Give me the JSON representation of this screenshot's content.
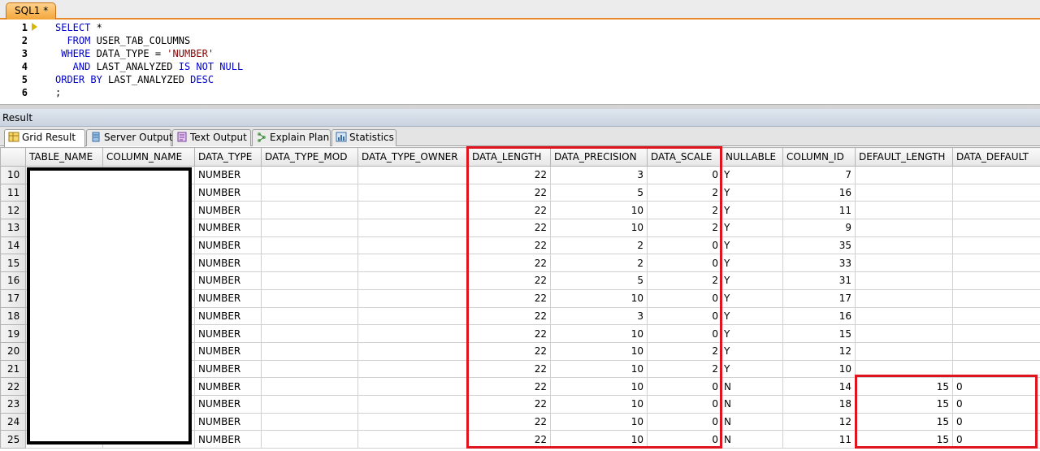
{
  "editor": {
    "tab_label": "SQL1 *",
    "line_numbers": [
      "1",
      "2",
      "3",
      "4",
      "5",
      "6"
    ],
    "lines": [
      [
        {
          "t": "SELECT",
          "k": "kw"
        },
        {
          "t": " *",
          "k": "plain"
        }
      ],
      [
        {
          "t": "  FROM",
          "k": "kw"
        },
        {
          "t": " USER_TAB_COLUMNS",
          "k": "plain"
        }
      ],
      [
        {
          "t": " WHERE",
          "k": "kw"
        },
        {
          "t": " DATA_TYPE = ",
          "k": "plain"
        },
        {
          "t": "'NUMBER'",
          "k": "str"
        }
      ],
      [
        {
          "t": "   AND",
          "k": "kw"
        },
        {
          "t": " LAST_ANALYZED ",
          "k": "plain"
        },
        {
          "t": "IS NOT NULL",
          "k": "kw"
        }
      ],
      [
        {
          "t": "ORDER BY",
          "k": "kw"
        },
        {
          "t": " LAST_ANALYZED ",
          "k": "plain"
        },
        {
          "t": "DESC",
          "k": "kw"
        }
      ],
      [
        {
          "t": ";",
          "k": "plain"
        }
      ]
    ]
  },
  "result": {
    "title": "Result",
    "tabs": [
      {
        "label": "Grid Result",
        "icon": "grid-result-icon",
        "active": true
      },
      {
        "label": "Server Output",
        "icon": "server-output-icon",
        "active": false
      },
      {
        "label": "Text Output",
        "icon": "text-output-icon",
        "active": false
      },
      {
        "label": "Explain Plan",
        "icon": "explain-plan-icon",
        "active": false
      },
      {
        "label": "Statistics",
        "icon": "statistics-icon",
        "active": false
      }
    ]
  },
  "grid": {
    "columns": [
      "TABLE_NAME",
      "COLUMN_NAME",
      "DATA_TYPE",
      "DATA_TYPE_MOD",
      "DATA_TYPE_OWNER",
      "DATA_LENGTH",
      "DATA_PRECISION",
      "DATA_SCALE",
      "NULLABLE",
      "COLUMN_ID",
      "DEFAULT_LENGTH",
      "DATA_DEFAULT"
    ],
    "rows": [
      {
        "n": "10",
        "cells": [
          "",
          "",
          "NUMBER",
          "",
          "",
          "22",
          "3",
          "0",
          "Y",
          "7",
          "",
          ""
        ]
      },
      {
        "n": "11",
        "cells": [
          "",
          "",
          "NUMBER",
          "",
          "",
          "22",
          "5",
          "2",
          "Y",
          "16",
          "",
          ""
        ]
      },
      {
        "n": "12",
        "cells": [
          "",
          "",
          "NUMBER",
          "",
          "",
          "22",
          "10",
          "2",
          "Y",
          "11",
          "",
          ""
        ]
      },
      {
        "n": "13",
        "cells": [
          "",
          "",
          "NUMBER",
          "",
          "",
          "22",
          "10",
          "2",
          "Y",
          "9",
          "",
          ""
        ]
      },
      {
        "n": "14",
        "cells": [
          "",
          "",
          "NUMBER",
          "",
          "",
          "22",
          "2",
          "0",
          "Y",
          "35",
          "",
          ""
        ]
      },
      {
        "n": "15",
        "cells": [
          "",
          "",
          "NUMBER",
          "",
          "",
          "22",
          "2",
          "0",
          "Y",
          "33",
          "",
          ""
        ]
      },
      {
        "n": "16",
        "cells": [
          "",
          "",
          "NUMBER",
          "",
          "",
          "22",
          "5",
          "2",
          "Y",
          "31",
          "",
          ""
        ]
      },
      {
        "n": "17",
        "cells": [
          "",
          "",
          "NUMBER",
          "",
          "",
          "22",
          "10",
          "0",
          "Y",
          "17",
          "",
          ""
        ]
      },
      {
        "n": "18",
        "cells": [
          "",
          "",
          "NUMBER",
          "",
          "",
          "22",
          "3",
          "0",
          "Y",
          "16",
          "",
          ""
        ]
      },
      {
        "n": "19",
        "cells": [
          "",
          "",
          "NUMBER",
          "",
          "",
          "22",
          "10",
          "0",
          "Y",
          "15",
          "",
          ""
        ]
      },
      {
        "n": "20",
        "cells": [
          "",
          "",
          "NUMBER",
          "",
          "",
          "22",
          "10",
          "2",
          "Y",
          "12",
          "",
          ""
        ]
      },
      {
        "n": "21",
        "cells": [
          "",
          "",
          "NUMBER",
          "",
          "",
          "22",
          "10",
          "2",
          "Y",
          "10",
          "",
          ""
        ]
      },
      {
        "n": "22",
        "cells": [
          "",
          "",
          "NUMBER",
          "",
          "",
          "22",
          "10",
          "0",
          "N",
          "14",
          "15",
          "0"
        ]
      },
      {
        "n": "23",
        "cells": [
          "",
          "",
          "NUMBER",
          "",
          "",
          "22",
          "10",
          "0",
          "N",
          "18",
          "15",
          "0"
        ]
      },
      {
        "n": "24",
        "cells": [
          "",
          "",
          "NUMBER",
          "",
          "",
          "22",
          "10",
          "0",
          "N",
          "12",
          "15",
          "0"
        ]
      },
      {
        "n": "25",
        "cells": [
          "",
          "",
          "NUMBER",
          "",
          "",
          "22",
          "10",
          "0",
          "N",
          "11",
          "15",
          "0"
        ]
      }
    ]
  },
  "colors": {
    "highlight": "#e0141f",
    "keyword": "#0000cc",
    "string": "#8b0000",
    "tab_accent": "#e8892b"
  }
}
